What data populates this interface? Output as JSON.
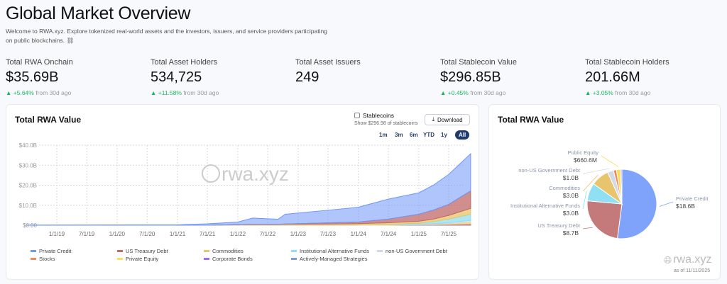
{
  "header": {
    "title": "Global Market Overview",
    "subtitle": "Welcome to RWA.xyz. Explore tokenized real-world assets and the investors, issuers, and service providers participating on public blockchains. ⛓"
  },
  "stats": [
    {
      "label": "Total RWA Onchain",
      "value": "$35.69B",
      "change": "▲ +5.64%",
      "suffix": " from 30d ago"
    },
    {
      "label": "Total Asset Holders",
      "value": "534,725",
      "change": "▲ +11.58%",
      "suffix": " from 30d ago"
    },
    {
      "label": "Total Asset Issuers",
      "value": "249",
      "change": "",
      "suffix": ""
    },
    {
      "label": "Total Stablecoin Value",
      "value": "$296.85B",
      "change": "▲ +0.45%",
      "suffix": " from 30d ago"
    },
    {
      "label": "Total Stablecoin Holders",
      "value": "201.66M",
      "change": "▲ +3.05%",
      "suffix": " from 30d ago"
    }
  ],
  "area_card": {
    "title": "Total RWA Value",
    "stablecoins_label": "Stablecoins",
    "stablecoins_note": "Show $296.98 of stablecoins",
    "stablecoins_checked": false,
    "download_label": "Download",
    "ranges": [
      "1m",
      "3m",
      "6m",
      "YTD",
      "1y",
      "All"
    ],
    "active_range": "All",
    "watermark": "rwa.xyz"
  },
  "pie_card": {
    "title": "Total RWA Value",
    "watermark": "rwa.xyz",
    "as_of": "as of 11/11/2025"
  },
  "chart_data": [
    {
      "type": "area",
      "stacked": true,
      "title": "Total RWA Value",
      "ylim": [
        0,
        40
      ],
      "y_ticks": [
        "$0.00",
        "$10.0B",
        "$20.0B",
        "$30.0B",
        "$40.0B"
      ],
      "x_ticks": [
        "1/1/19",
        "7/1/19",
        "1/1/20",
        "7/1/20",
        "1/1/21",
        "7/1/21",
        "1/1/22",
        "7/1/22",
        "1/1/23",
        "7/1/23",
        "1/1/24",
        "7/1/24",
        "1/1/25",
        "7/1/25"
      ],
      "x_tick_dates": [
        "2019-01-01",
        "2019-07-01",
        "2020-01-01",
        "2020-07-01",
        "2021-01-01",
        "2021-07-01",
        "2022-01-01",
        "2022-07-01",
        "2023-01-01",
        "2023-07-01",
        "2024-01-01",
        "2024-07-01",
        "2025-01-01",
        "2025-07-01"
      ],
      "grid": true,
      "legend_position": "bottom",
      "x": [
        "2018-07-01",
        "2021-01-01",
        "2021-07-01",
        "2022-01-01",
        "2022-04-01",
        "2022-09-01",
        "2022-10-15",
        "2023-07-01",
        "2024-01-01",
        "2024-07-01",
        "2025-01-01",
        "2025-04-01",
        "2025-07-01",
        "2025-11-11"
      ],
      "series": [
        {
          "name": "Private Credit",
          "color": "#6f96f7",
          "values": [
            0.1,
            0.2,
            0.7,
            1.3,
            3.1,
            2.5,
            4.9,
            6.3,
            7.4,
            10.0,
            10.7,
            12.5,
            15.0,
            18.6
          ]
        },
        {
          "name": "US Treasury Debt",
          "color": "#c06868",
          "values": [
            0,
            0,
            0,
            0.1,
            0.1,
            0.1,
            0.1,
            0.6,
            0.8,
            1.8,
            3.5,
            4.5,
            5.5,
            8.7
          ]
        },
        {
          "name": "Commodities",
          "color": "#e8c46a",
          "values": [
            0,
            0,
            0,
            0.2,
            0.4,
            0.4,
            0.5,
            0.6,
            0.7,
            0.9,
            1.0,
            1.3,
            1.8,
            3.0
          ]
        },
        {
          "name": "Institutional Alternative Funds",
          "color": "#8fdff2",
          "values": [
            0,
            0,
            0,
            0,
            0,
            0,
            0,
            0,
            0,
            0.1,
            0.5,
            1.0,
            1.8,
            3.0
          ]
        },
        {
          "name": "non-US Government Debt",
          "color": "#cfd8e6",
          "values": [
            0,
            0,
            0,
            0,
            0,
            0,
            0,
            0,
            0.05,
            0.1,
            0.2,
            0.3,
            0.5,
            1.0
          ]
        },
        {
          "name": "Stocks",
          "color": "#f08a5d",
          "values": [
            0,
            0,
            0,
            0,
            0,
            0,
            0,
            0,
            0,
            0,
            0.05,
            0.1,
            0.2,
            0.4
          ]
        },
        {
          "name": "Private Equity",
          "color": "#f7e05a",
          "values": [
            0,
            0,
            0,
            0,
            0,
            0,
            0,
            0,
            0.05,
            0.1,
            0.1,
            0.2,
            0.3,
            0.66
          ]
        },
        {
          "name": "Corporate Bonds",
          "color": "#9a6ee8",
          "values": [
            0,
            0,
            0,
            0,
            0,
            0,
            0,
            0,
            0,
            0.05,
            0.1,
            0.1,
            0.2,
            0.2
          ]
        },
        {
          "name": "Actively-Managed Strategies",
          "color": "#7f9ccc",
          "values": [
            0,
            0,
            0,
            0,
            0,
            0,
            0,
            0,
            0,
            0,
            0.05,
            0.1,
            0.1,
            0.2
          ]
        }
      ]
    },
    {
      "type": "pie",
      "title": "Total RWA Value",
      "slices": [
        {
          "name": "Private Credit",
          "label": "Private Credit",
          "value_label": "$18.6B",
          "value": 18.6,
          "color": "#7fa3fb"
        },
        {
          "name": "US Treasury Debt",
          "label": "US Treasury Debt",
          "value_label": "$8.7B",
          "value": 8.7,
          "color": "#c47a7a"
        },
        {
          "name": "Institutional Alternative Funds",
          "label": "Institutional Alternative Funds",
          "value_label": "$3.0B",
          "value": 3.0,
          "color": "#8fe0f3"
        },
        {
          "name": "Commodities",
          "label": "Commodities",
          "value_label": "$3.0B",
          "value": 3.0,
          "color": "#e8c56c"
        },
        {
          "name": "non-US Government Debt",
          "label": "non-US Government Debt",
          "value_label": "$1.0B",
          "value": 1.0,
          "color": "#d3dae6"
        },
        {
          "name": "Stocks",
          "label": "",
          "value_label": "",
          "value": 0.5,
          "color": "#f0875a"
        },
        {
          "name": "Public Equity",
          "label": "Public Equity",
          "value_label": "$660.6M",
          "value": 0.66,
          "color": "#f9dd55"
        },
        {
          "name": "Actively-Managed Strategies",
          "label": "",
          "value_label": "",
          "value": 0.25,
          "color": "#a8b6e8"
        }
      ]
    }
  ]
}
